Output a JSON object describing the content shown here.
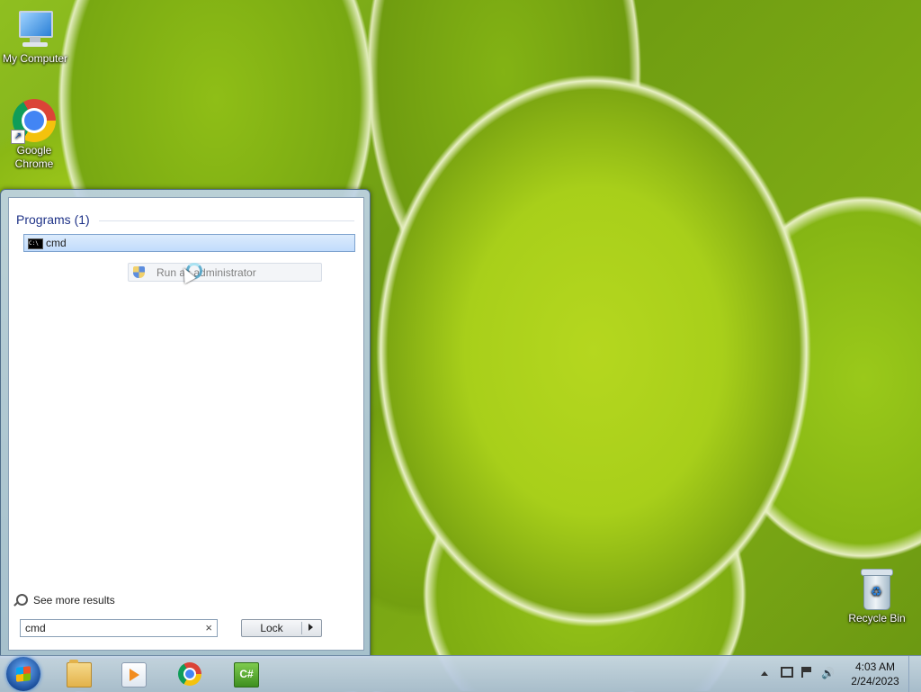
{
  "desktop": {
    "icons": [
      {
        "label": "My Computer"
      },
      {
        "label": "Google Chrome"
      },
      {
        "label": "Recycle Bin"
      }
    ]
  },
  "start_menu": {
    "programs_header": "Programs (1)",
    "results": [
      {
        "label": "cmd",
        "icon": "console-icon"
      }
    ],
    "context_item": {
      "label": "Run as administrator",
      "icon": "uac-shield-icon"
    },
    "see_more": "See more results",
    "search": {
      "value": "cmd",
      "clear_glyph": "×"
    },
    "lock_button": "Lock"
  },
  "taskbar": {
    "pinned": [
      {
        "name": "windows-explorer",
        "icon": "folder-icon"
      },
      {
        "name": "media-player",
        "icon": "media-player-icon"
      },
      {
        "name": "google-chrome",
        "icon": "chrome-icon"
      },
      {
        "name": "csharp-app",
        "icon": "csharp-icon",
        "label": "C#"
      }
    ],
    "clock": {
      "time": "4:03 AM",
      "date": "2/24/2023"
    },
    "tray_volume_glyph": "🔊"
  }
}
